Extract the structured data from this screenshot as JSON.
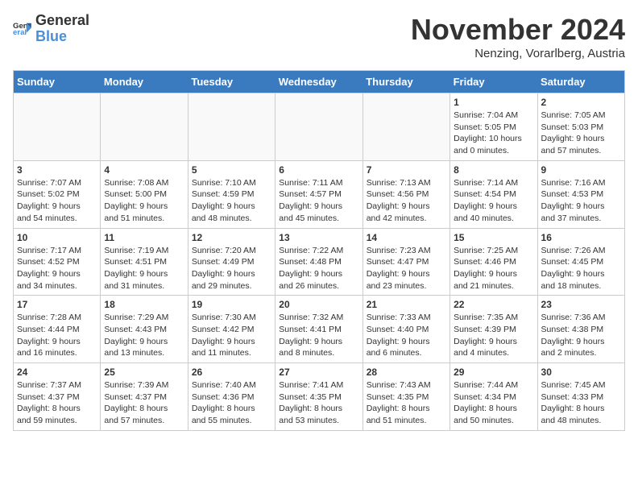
{
  "logo": {
    "general": "General",
    "blue": "Blue"
  },
  "title": "November 2024",
  "subtitle": "Nenzing, Vorarlberg, Austria",
  "days_of_week": [
    "Sunday",
    "Monday",
    "Tuesday",
    "Wednesday",
    "Thursday",
    "Friday",
    "Saturday"
  ],
  "weeks": [
    [
      {
        "day": "",
        "info": "",
        "empty": true
      },
      {
        "day": "",
        "info": "",
        "empty": true
      },
      {
        "day": "",
        "info": "",
        "empty": true
      },
      {
        "day": "",
        "info": "",
        "empty": true
      },
      {
        "day": "",
        "info": "",
        "empty": true
      },
      {
        "day": "1",
        "info": "Sunrise: 7:04 AM\nSunset: 5:05 PM\nDaylight: 10 hours\nand 0 minutes."
      },
      {
        "day": "2",
        "info": "Sunrise: 7:05 AM\nSunset: 5:03 PM\nDaylight: 9 hours\nand 57 minutes."
      }
    ],
    [
      {
        "day": "3",
        "info": "Sunrise: 7:07 AM\nSunset: 5:02 PM\nDaylight: 9 hours\nand 54 minutes."
      },
      {
        "day": "4",
        "info": "Sunrise: 7:08 AM\nSunset: 5:00 PM\nDaylight: 9 hours\nand 51 minutes."
      },
      {
        "day": "5",
        "info": "Sunrise: 7:10 AM\nSunset: 4:59 PM\nDaylight: 9 hours\nand 48 minutes."
      },
      {
        "day": "6",
        "info": "Sunrise: 7:11 AM\nSunset: 4:57 PM\nDaylight: 9 hours\nand 45 minutes."
      },
      {
        "day": "7",
        "info": "Sunrise: 7:13 AM\nSunset: 4:56 PM\nDaylight: 9 hours\nand 42 minutes."
      },
      {
        "day": "8",
        "info": "Sunrise: 7:14 AM\nSunset: 4:54 PM\nDaylight: 9 hours\nand 40 minutes."
      },
      {
        "day": "9",
        "info": "Sunrise: 7:16 AM\nSunset: 4:53 PM\nDaylight: 9 hours\nand 37 minutes."
      }
    ],
    [
      {
        "day": "10",
        "info": "Sunrise: 7:17 AM\nSunset: 4:52 PM\nDaylight: 9 hours\nand 34 minutes."
      },
      {
        "day": "11",
        "info": "Sunrise: 7:19 AM\nSunset: 4:51 PM\nDaylight: 9 hours\nand 31 minutes."
      },
      {
        "day": "12",
        "info": "Sunrise: 7:20 AM\nSunset: 4:49 PM\nDaylight: 9 hours\nand 29 minutes."
      },
      {
        "day": "13",
        "info": "Sunrise: 7:22 AM\nSunset: 4:48 PM\nDaylight: 9 hours\nand 26 minutes."
      },
      {
        "day": "14",
        "info": "Sunrise: 7:23 AM\nSunset: 4:47 PM\nDaylight: 9 hours\nand 23 minutes."
      },
      {
        "day": "15",
        "info": "Sunrise: 7:25 AM\nSunset: 4:46 PM\nDaylight: 9 hours\nand 21 minutes."
      },
      {
        "day": "16",
        "info": "Sunrise: 7:26 AM\nSunset: 4:45 PM\nDaylight: 9 hours\nand 18 minutes."
      }
    ],
    [
      {
        "day": "17",
        "info": "Sunrise: 7:28 AM\nSunset: 4:44 PM\nDaylight: 9 hours\nand 16 minutes."
      },
      {
        "day": "18",
        "info": "Sunrise: 7:29 AM\nSunset: 4:43 PM\nDaylight: 9 hours\nand 13 minutes."
      },
      {
        "day": "19",
        "info": "Sunrise: 7:30 AM\nSunset: 4:42 PM\nDaylight: 9 hours\nand 11 minutes."
      },
      {
        "day": "20",
        "info": "Sunrise: 7:32 AM\nSunset: 4:41 PM\nDaylight: 9 hours\nand 8 minutes."
      },
      {
        "day": "21",
        "info": "Sunrise: 7:33 AM\nSunset: 4:40 PM\nDaylight: 9 hours\nand 6 minutes."
      },
      {
        "day": "22",
        "info": "Sunrise: 7:35 AM\nSunset: 4:39 PM\nDaylight: 9 hours\nand 4 minutes."
      },
      {
        "day": "23",
        "info": "Sunrise: 7:36 AM\nSunset: 4:38 PM\nDaylight: 9 hours\nand 2 minutes."
      }
    ],
    [
      {
        "day": "24",
        "info": "Sunrise: 7:37 AM\nSunset: 4:37 PM\nDaylight: 8 hours\nand 59 minutes."
      },
      {
        "day": "25",
        "info": "Sunrise: 7:39 AM\nSunset: 4:37 PM\nDaylight: 8 hours\nand 57 minutes."
      },
      {
        "day": "26",
        "info": "Sunrise: 7:40 AM\nSunset: 4:36 PM\nDaylight: 8 hours\nand 55 minutes."
      },
      {
        "day": "27",
        "info": "Sunrise: 7:41 AM\nSunset: 4:35 PM\nDaylight: 8 hours\nand 53 minutes."
      },
      {
        "day": "28",
        "info": "Sunrise: 7:43 AM\nSunset: 4:35 PM\nDaylight: 8 hours\nand 51 minutes."
      },
      {
        "day": "29",
        "info": "Sunrise: 7:44 AM\nSunset: 4:34 PM\nDaylight: 8 hours\nand 50 minutes."
      },
      {
        "day": "30",
        "info": "Sunrise: 7:45 AM\nSunset: 4:33 PM\nDaylight: 8 hours\nand 48 minutes."
      }
    ]
  ]
}
